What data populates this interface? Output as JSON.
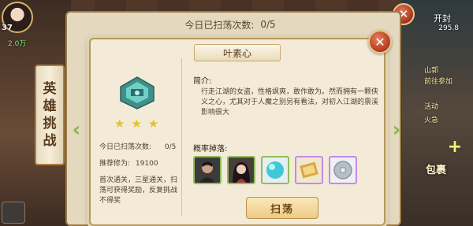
{
  "player": {
    "level": "37",
    "power": "2.0万"
  },
  "hero_banner": {
    "chars": [
      "英",
      "雄",
      "挑",
      "战"
    ]
  },
  "hud": {
    "open_label": "开封",
    "stat": "295.8",
    "tasks": [
      "山郭",
      "前往参加",
      "活动",
      "火急"
    ],
    "bag_label": "包裹"
  },
  "outer_dialog": {
    "title": "今日已扫荡次数:",
    "count": "0/5",
    "close_icon": "close-icon"
  },
  "inner_dialog": {
    "name": "叶素心",
    "close_icon": "close-icon",
    "stars": [
      "★",
      "★",
      "★"
    ],
    "sweep_count_label": "今日已扫荡次数:",
    "sweep_count_value": "0/5",
    "recommended_label": "推荐修为:",
    "recommended_value": "19100",
    "first_clear_text": "首次通关，三星通关，扫荡可获得奖励，反复挑战不得奖",
    "intro_label": "简介:",
    "intro_text": "行走江湖的女盗，性格飒爽，敢作敢为。然而拥有一颗侠义之心，尤其对于人魔之别另有看法，对初入江湖的禀溪影响很大",
    "drops_label": "概率掉落:",
    "drops": [
      {
        "icon": "male-hero-portrait-icon",
        "rarity": "green"
      },
      {
        "icon": "female-hero-portrait-icon",
        "rarity": "green"
      },
      {
        "icon": "blue-orb-icon",
        "rarity": "green"
      },
      {
        "icon": "scroll-icon",
        "rarity": "purple"
      },
      {
        "icon": "silver-coin-icon",
        "rarity": "purple"
      }
    ],
    "sweep_button": "扫荡"
  },
  "colors": {
    "panel_bg": "#f3ebd8",
    "border_gold": "#b49862",
    "button_gold": "#eecb84",
    "close_red": "#b13a20",
    "star_yellow": "#e7c22b",
    "green_rarity": "#8cc05a",
    "purple_rarity": "#c48ae6"
  }
}
